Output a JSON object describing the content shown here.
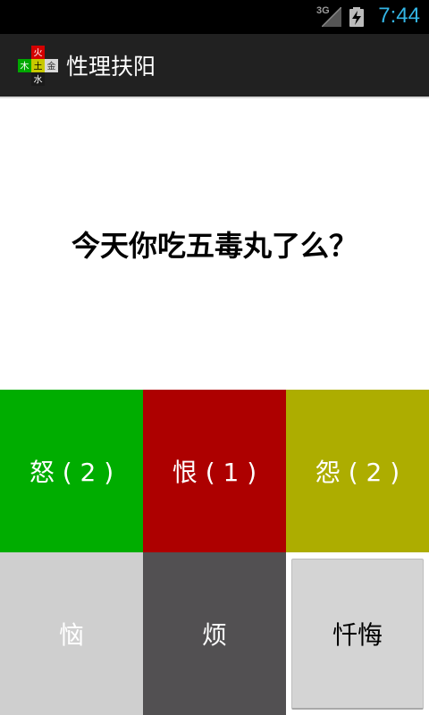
{
  "status_bar": {
    "network_type": "3G",
    "time": "7:44",
    "signal_icon": "signal-icon",
    "battery_icon": "battery-charging-icon"
  },
  "action_bar": {
    "title": "性理扶阳",
    "icon": {
      "name": "app-logo-icon",
      "top_char": "火",
      "left_char": "木",
      "center_char": "土",
      "right_char": "金",
      "bottom_char": "水"
    }
  },
  "question": "今天你吃五毒丸了么？",
  "buttons": {
    "nu": {
      "label": "怒 ( 2 )",
      "color": "#00ad00"
    },
    "hen": {
      "label": "恨 ( 1 )",
      "color": "#ad0000"
    },
    "yuan": {
      "label": "怨 ( 2 )",
      "color": "#adad00"
    },
    "nao": {
      "label": "恼",
      "color": "#cfcfcf"
    },
    "fan": {
      "label": "烦",
      "color": "#525052"
    },
    "chanhui": {
      "label": "忏悔",
      "color": "#d4d4d4"
    }
  }
}
